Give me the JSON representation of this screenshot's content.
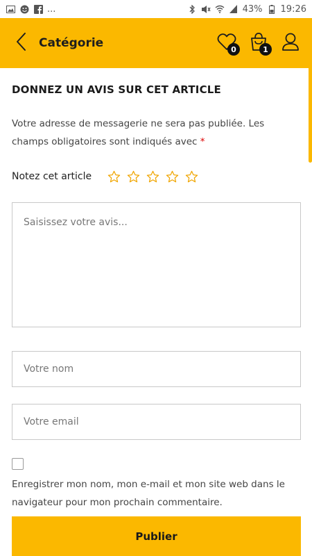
{
  "status_bar": {
    "left_icons": [
      "image-icon",
      "emoji-icon",
      "facebook-icon",
      "more-icon"
    ],
    "more_text": "...",
    "right_icons": [
      "bluetooth-icon",
      "mute-icon",
      "wifi-icon",
      "signal-icon",
      "battery-icon"
    ],
    "battery": "43%",
    "time": "19:26"
  },
  "header": {
    "title": "Catégorie",
    "wishlist_count": "0",
    "cart_count": "1"
  },
  "review": {
    "heading": "DONNEZ UN AVIS SUR CET ARTICLE",
    "notice": "Votre adresse de messagerie ne sera pas publiée. Les champs obligatoires sont indiqués avec",
    "required_mark": "*",
    "rating_label": "Notez cet article",
    "rating_max": 5,
    "rating_value": 0,
    "textarea_placeholder": "Saisissez votre avis...",
    "name_placeholder": "Votre nom",
    "email_placeholder": "Votre email",
    "consent_text": "Enregistrer mon nom, mon e-mail et mon site web dans le navigateur pour mon prochain commentaire.",
    "consent_checked": false,
    "submit_label": "Publier"
  },
  "colors": {
    "accent": "#fbb800",
    "star": "#f0a500",
    "required": "#dd0000"
  }
}
